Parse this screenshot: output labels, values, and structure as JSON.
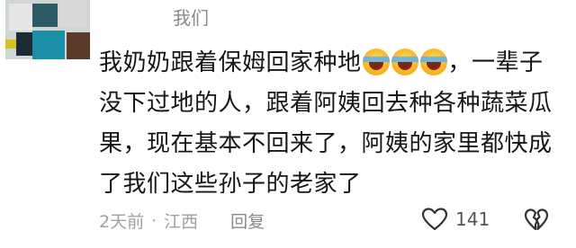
{
  "comment": {
    "username": "我们",
    "text_line1": "我奶奶跟着保姆回家种地",
    "text_line1_end": "，一辈子",
    "text_rest": "没下过地的人，跟着阿姨回去种各种蔬菜瓜果，现在基本不回来了，阿姨的家里都快成了我们这些孙子的老家了",
    "emojis": [
      "laugh-cry-icon",
      "laugh-cry-icon",
      "laugh-cry-icon"
    ],
    "time": "2天前",
    "dot": "·",
    "location": "江西",
    "reply_label": "回复",
    "like_count": "141"
  },
  "colors": {
    "text": "#161616",
    "meta": "#a0a0a0",
    "emoji": "#f6a81a"
  }
}
